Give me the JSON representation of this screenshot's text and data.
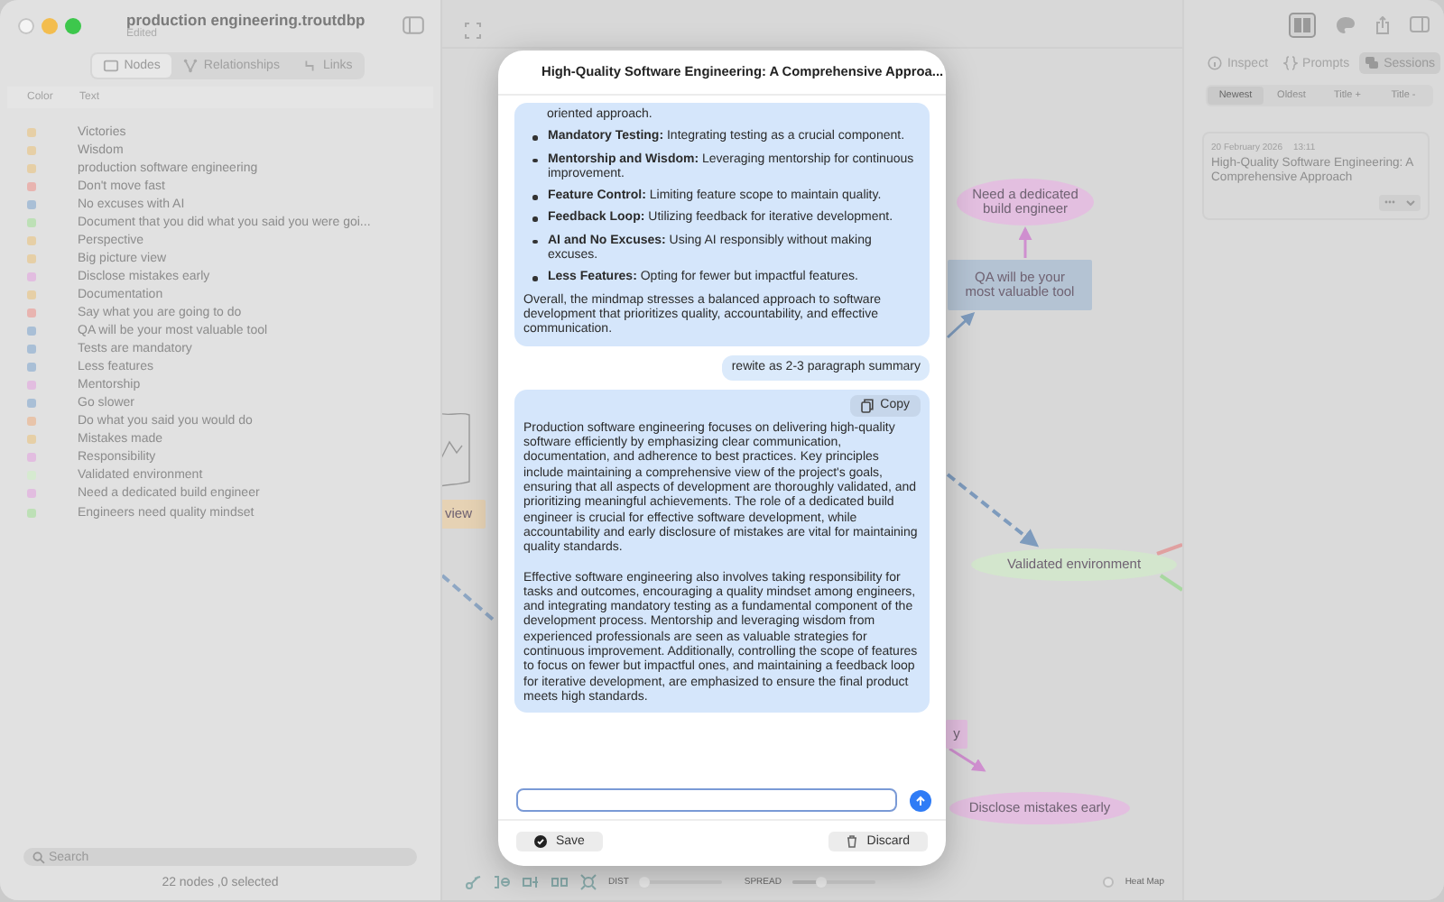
{
  "window": {
    "title": "production engineering.troutdbp",
    "subtitle": "Edited"
  },
  "sidebar": {
    "tabs": [
      {
        "label": "Nodes",
        "selected": true
      },
      {
        "label": "Relationships",
        "selected": false
      },
      {
        "label": "Links",
        "selected": false
      }
    ],
    "columns": [
      "Color",
      "Text"
    ],
    "nodes": [
      {
        "color": "#e6cfa6",
        "text": "Victories"
      },
      {
        "color": "#e6cfa6",
        "text": "Wisdom"
      },
      {
        "color": "#e6cfa6",
        "text": "production software engineering"
      },
      {
        "color": "#e8b4b0",
        "text": "Don't move fast"
      },
      {
        "color": "#a9bfd6",
        "text": "No excuses with AI"
      },
      {
        "color": "#bde0b6",
        "text": "Document that you did what you said you were goi..."
      },
      {
        "color": "#e6cfa6",
        "text": "Perspective"
      },
      {
        "color": "#e6cfa6",
        "text": "Big picture view"
      },
      {
        "color": "#e2bde0",
        "text": "Disclose mistakes early"
      },
      {
        "color": "#e6cfa6",
        "text": "Documentation"
      },
      {
        "color": "#e8b4b0",
        "text": "Say what you are going to do"
      },
      {
        "color": "#a9bfd6",
        "text": "QA will be your most valuable tool"
      },
      {
        "color": "#a9bfd6",
        "text": "Tests are mandatory"
      },
      {
        "color": "#a9bfd6",
        "text": "Less features"
      },
      {
        "color": "#e2bde0",
        "text": "Mentorship"
      },
      {
        "color": "#a9bfd6",
        "text": "Go slower"
      },
      {
        "color": "#e8c4aa",
        "text": "Do what you said you would do"
      },
      {
        "color": "#e6cfa6",
        "text": "Mistakes made"
      },
      {
        "color": "#e2bde0",
        "text": "Responsibility"
      },
      {
        "color": "#d6ead0",
        "text": "Validated environment"
      },
      {
        "color": "#e2bde0",
        "text": "Need a dedicated build engineer"
      },
      {
        "color": "#bde0b6",
        "text": "Engineers need quality mindset"
      }
    ],
    "search": {
      "placeholder": "Search"
    },
    "status": "22 nodes ,0 selected"
  },
  "canvas": {
    "nodes": [
      {
        "kind": "ellipse",
        "text": "Need a dedicated build engineer",
        "color": "#e3bfe0"
      },
      {
        "kind": "rect",
        "text": "QA will be your most valuable tool",
        "color": "#b4c3d3"
      },
      {
        "kind": "ellipse",
        "text": "Validated environment",
        "color": "#d3e6cd"
      },
      {
        "kind": "rect",
        "text": "y",
        "color": "#e3bfe0"
      },
      {
        "kind": "ellipse",
        "text": "Disclose mistakes early",
        "color": "#e3bfe0"
      },
      {
        "kind": "rect",
        "text": "view",
        "color": "#e6d2b4"
      }
    ],
    "toolbar": {
      "sliders": [
        {
          "label": "DIST",
          "level": 0.05
        },
        {
          "label": "SPREAD",
          "level": 0.35
        }
      ],
      "heat_map": {
        "label": "Heat Map",
        "checked": false
      }
    }
  },
  "inspector": {
    "tabs": [
      {
        "label": "Inspect",
        "selected": false
      },
      {
        "label": "Prompts",
        "selected": false
      },
      {
        "label": "Sessions",
        "selected": true
      }
    ],
    "sort": [
      {
        "label": "Newest",
        "selected": true
      },
      {
        "label": "Oldest",
        "selected": false
      },
      {
        "label": "Title +",
        "selected": false
      },
      {
        "label": "Title -",
        "selected": false
      }
    ],
    "sessions": [
      {
        "date": "20 February 2026",
        "time": "13:11",
        "title": "High-Quality Software Engineering: A Comprehensive Approach"
      }
    ]
  },
  "chat": {
    "title": "High-Quality Software Engineering: A Comprehensive Approa...",
    "messages": [
      {
        "kind": "assistant_list",
        "intro": "oriented approach.",
        "bullets": [
          "**Mandatory Testing:** Integrating testing as a crucial component.",
          "**Mentorship and Wisdom:** Leveraging mentorship for continuous improvement.",
          "**Feature Control:** Limiting feature scope to maintain quality.",
          "**Feedback Loop:** Utilizing feedback for iterative development.",
          "**AI and No Excuses:** Using AI responsibly without making excuses.",
          "**Less Features:** Opting for fewer but impactful features."
        ],
        "summary": "Overall, the mindmap stresses a balanced approach to software development that prioritizes quality, accountability, and effective communication."
      },
      {
        "kind": "user",
        "text": "rewite as 2-3 paragraph summary"
      },
      {
        "kind": "assistant_text",
        "copy": "Copy",
        "paragraphs": [
          "Production software engineering focuses on delivering high-quality software efficiently by emphasizing clear communication, documentation, and adherence to best practices. Key principles include maintaining a comprehensive view of the project's goals, ensuring that all aspects of development are thoroughly validated, and prioritizing meaningful achievements. The role of a dedicated build engineer is crucial for effective software development, while accountability and early disclosure of mistakes are vital for maintaining quality standards.",
          "Effective software engineering also involves taking responsibility for tasks and outcomes, encouraging a quality mindset among engineers, and integrating mandatory testing as a fundamental component of the development process. Mentorship and leveraging wisdom from experienced professionals are seen as valuable strategies for continuous improvement. Additionally, controlling the scope of features to focus on fewer but impactful ones, and maintaining a feedback loop for iterative development, are emphasized to ensure the final product meets high standards."
        ]
      }
    ],
    "save": "Save",
    "discard": "Discard"
  }
}
